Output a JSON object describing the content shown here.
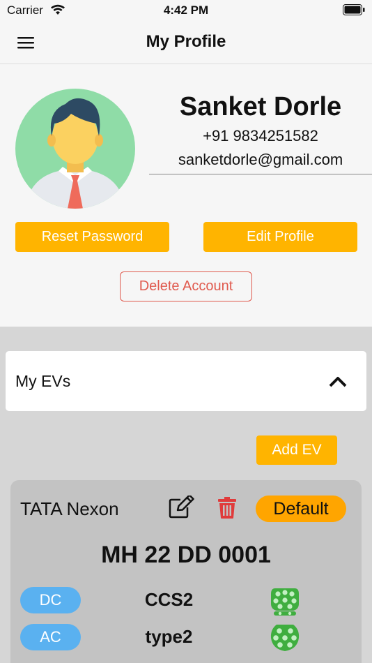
{
  "status_bar": {
    "carrier": "Carrier",
    "time": "4:42 PM"
  },
  "header": {
    "title": "My Profile"
  },
  "profile": {
    "name": "Sanket Dorle",
    "phone": "+91 9834251582",
    "email": "sanketdorle@gmail.com",
    "reset_password_label": "Reset Password",
    "edit_profile_label": "Edit Profile",
    "delete_account_label": "Delete Account"
  },
  "evs": {
    "section_title": "My EVs",
    "add_ev_label": "Add EV",
    "vehicles": [
      {
        "model": "TATA Nexon",
        "default_label": "Default",
        "registration": "MH 22 DD 0001",
        "chargers": [
          {
            "type": "DC",
            "connector": "CCS2",
            "icon": "ccs2-connector-icon"
          },
          {
            "type": "AC",
            "connector": "type2",
            "icon": "type2-connector-icon"
          }
        ]
      }
    ]
  },
  "colors": {
    "accent_yellow": "#ffb400",
    "default_badge": "#ffa500",
    "danger": "#e05a4e",
    "pill_blue": "#5ab1f0",
    "plug_green": "#3fae3f"
  }
}
